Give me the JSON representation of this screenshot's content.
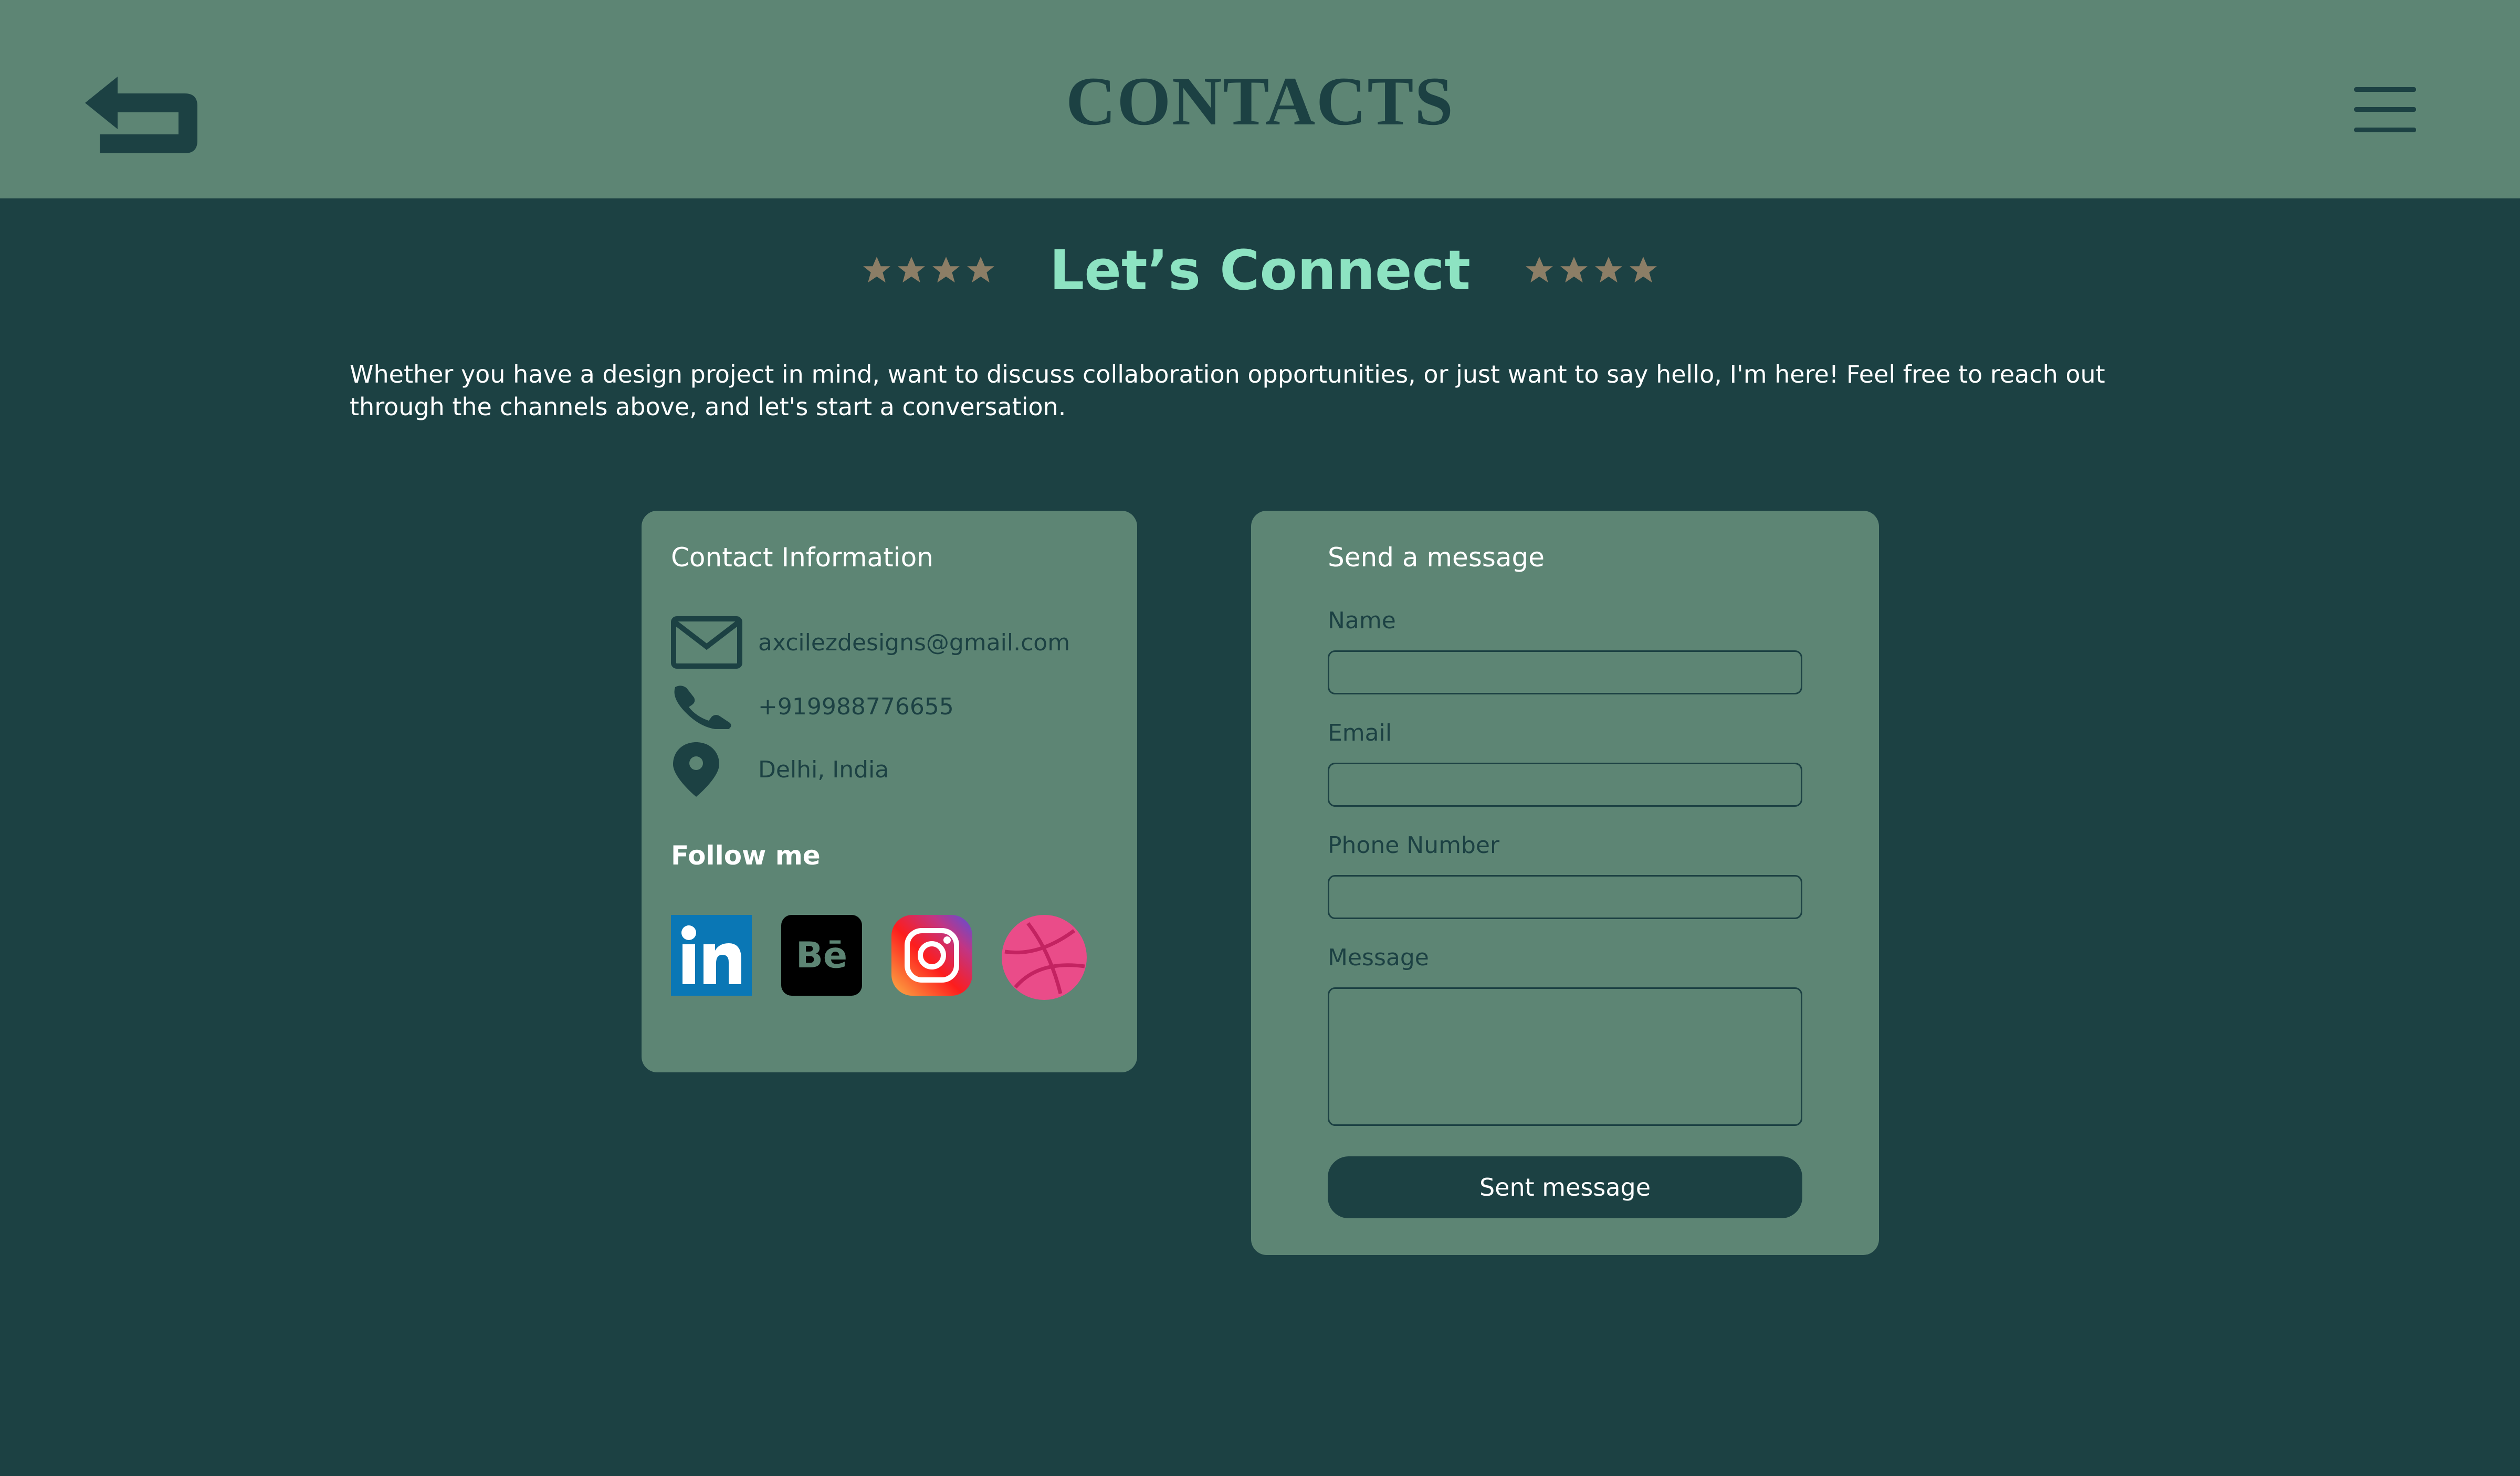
{
  "header": {
    "title": "CONTACTS",
    "back_icon": "back-arrow-icon",
    "menu_icon": "hamburger-menu-icon"
  },
  "hero": {
    "title": "Let’s Connect",
    "star_icon": "star-icon",
    "star_count_each_side": 4,
    "intro": "Whether you have a design project in mind, want to discuss collaboration opportunities, or just want to say hello, I'm here! Feel free to reach out through the channels above, and let's start a conversation."
  },
  "contact_info": {
    "heading": "Contact Information",
    "email": "axcilezdesigns@gmail.com",
    "phone": "+919988776655",
    "location": "Delhi, India",
    "follow_heading": "Follow me",
    "socials": [
      "linkedin-icon",
      "behance-icon",
      "instagram-icon",
      "dribbble-icon"
    ]
  },
  "message_form": {
    "heading": "Send a message",
    "name_label": "Name",
    "email_label": "Email",
    "phone_label": "Phone Number",
    "message_label": "Message",
    "submit_label": "Sent message"
  },
  "colors": {
    "background": "#1c4143",
    "header": "#5d8574",
    "card": "#5d8574",
    "accent": "#8de3c2",
    "star": "#8c7e66"
  }
}
